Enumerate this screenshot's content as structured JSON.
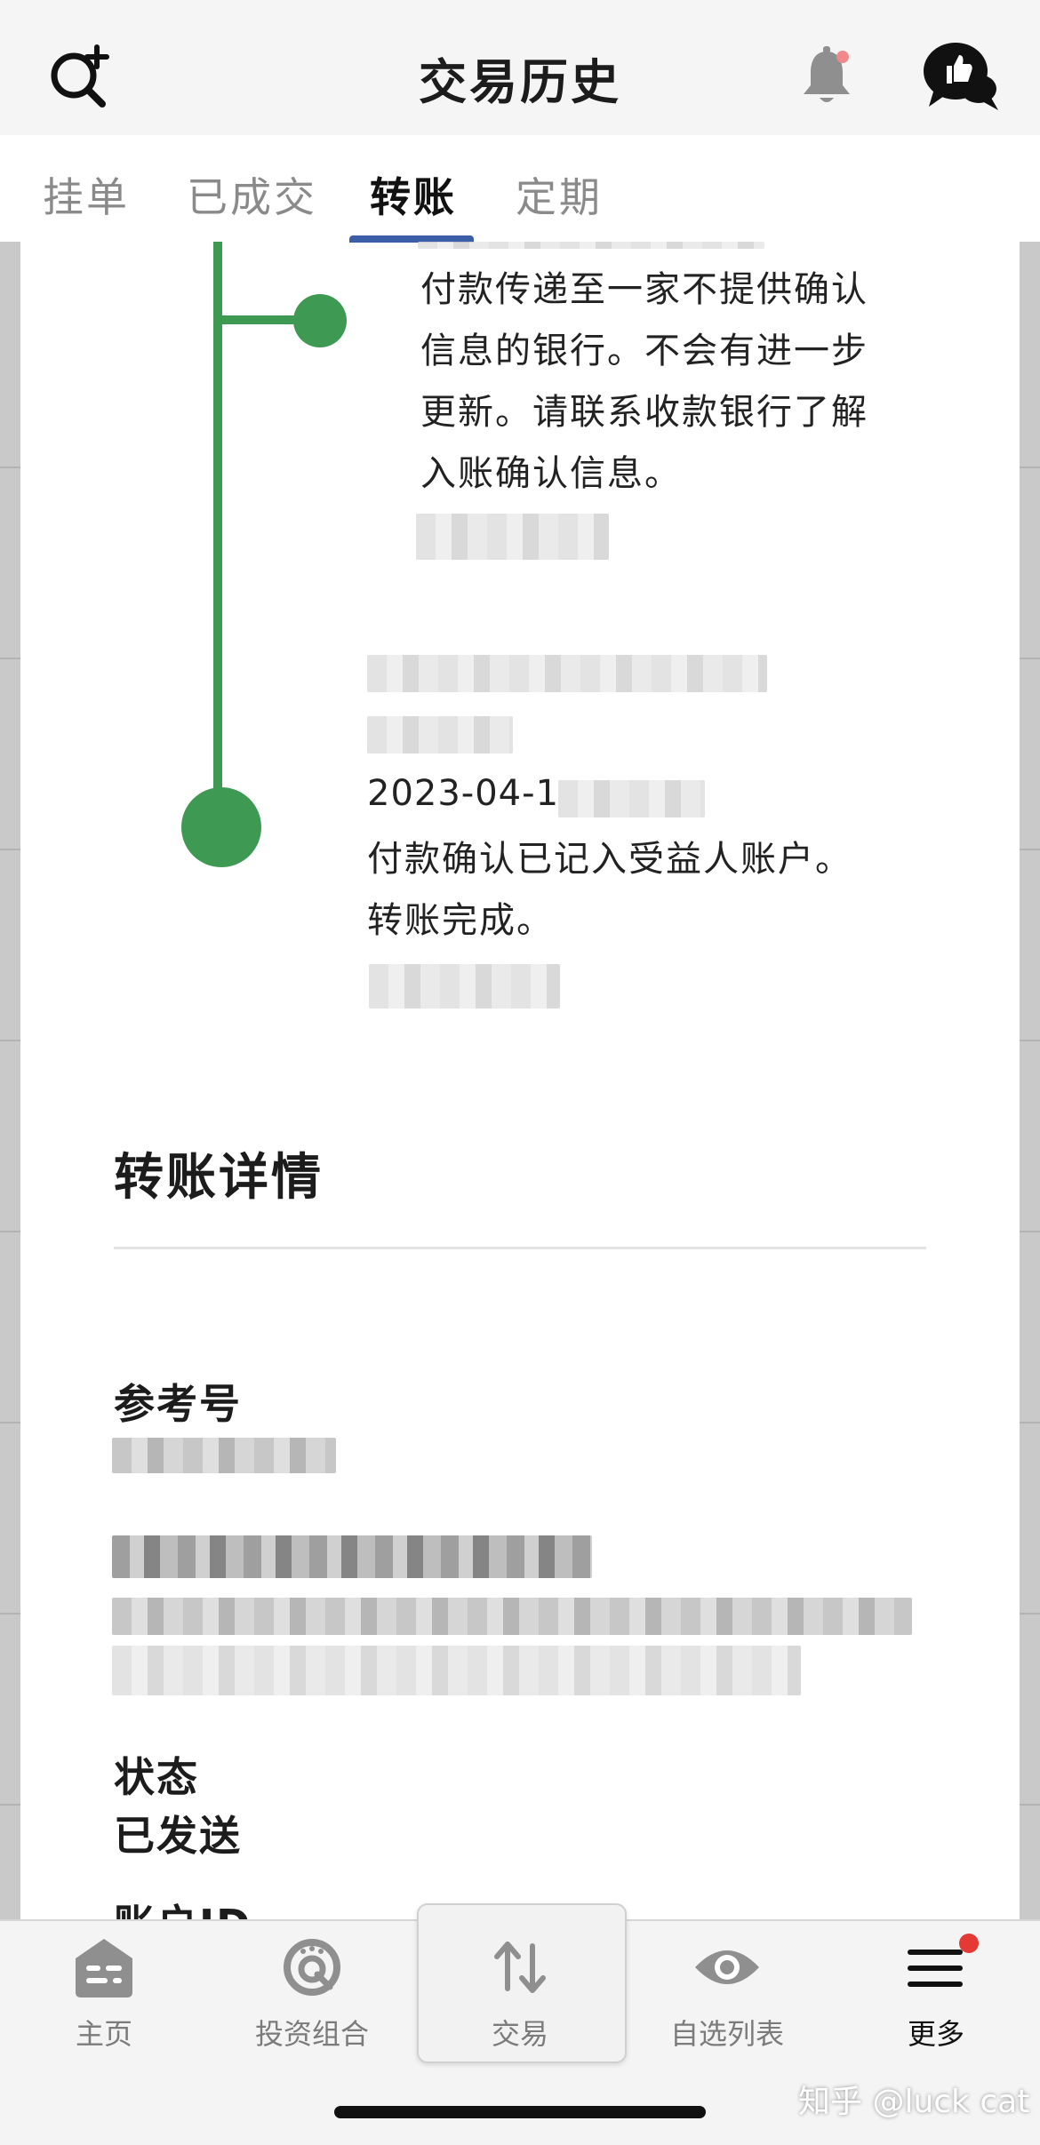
{
  "header": {
    "title": "交易历史",
    "search_icon": "search-plus-icon",
    "bell_icon": "bell-icon",
    "chat_icon": "thumbs-up-chat-icon"
  },
  "tabs": [
    {
      "label": "挂单",
      "active": false
    },
    {
      "label": "已成交",
      "active": false
    },
    {
      "label": "转账",
      "active": true
    },
    {
      "label": "定期",
      "active": false
    }
  ],
  "timeline": {
    "event1": {
      "lines": [
        "付款传递至一家不提供确认",
        "信息的银行。不会有进一步",
        "更新。请联系收款银行了解",
        "入账确认信息。"
      ]
    },
    "event2": {
      "date": "2023-04-1",
      "lines": [
        "付款确认已记入受益人账户。",
        "转账完成。"
      ]
    }
  },
  "details": {
    "title": "转账详情",
    "reference_label": "参考号",
    "status_label": "状态",
    "status_value": "已发送",
    "account_label_partial": "账户ID"
  },
  "bottom_nav": [
    {
      "label": "主页",
      "icon": "home-icon"
    },
    {
      "label": "投资组合",
      "icon": "portfolio-gauge-icon"
    },
    {
      "label": "交易",
      "icon": "trade-arrows-icon",
      "active": true
    },
    {
      "label": "自选列表",
      "icon": "eye-icon"
    },
    {
      "label": "更多",
      "icon": "menu-icon"
    }
  ],
  "watermark": "知乎 @luck cat",
  "colors": {
    "accent_green": "#3e9a52",
    "tab_underline": "#3c5ea8",
    "badge_red": "#e53935"
  }
}
